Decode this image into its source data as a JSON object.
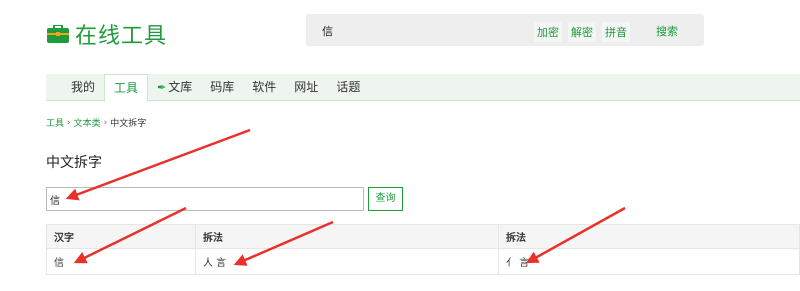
{
  "header": {
    "site_title": "在线工具",
    "search_value": "信",
    "actions": [
      "加密",
      "解密",
      "拼音"
    ],
    "search_button": "搜索"
  },
  "nav": {
    "tabs": [
      {
        "label": "我的",
        "icon": null,
        "active": false
      },
      {
        "label": "工具",
        "icon": null,
        "active": true
      },
      {
        "label": "文库",
        "icon": "feather-icon",
        "active": false
      },
      {
        "label": "码库",
        "icon": null,
        "active": false
      },
      {
        "label": "软件",
        "icon": null,
        "active": false
      },
      {
        "label": "网址",
        "icon": null,
        "active": false
      },
      {
        "label": "话题",
        "icon": null,
        "active": false
      }
    ]
  },
  "breadcrumb": {
    "items": [
      "工具",
      "文本类"
    ],
    "current": "中文拆字"
  },
  "page": {
    "title": "中文拆字",
    "query_value": "信",
    "query_button": "查询"
  },
  "table": {
    "headers": [
      "汉字",
      "拆法",
      "拆法"
    ],
    "rows": [
      [
        "信",
        "人 言",
        "亻 言"
      ]
    ]
  },
  "colors": {
    "accent": "#1e9b3c",
    "annotation": "#e8312a"
  }
}
